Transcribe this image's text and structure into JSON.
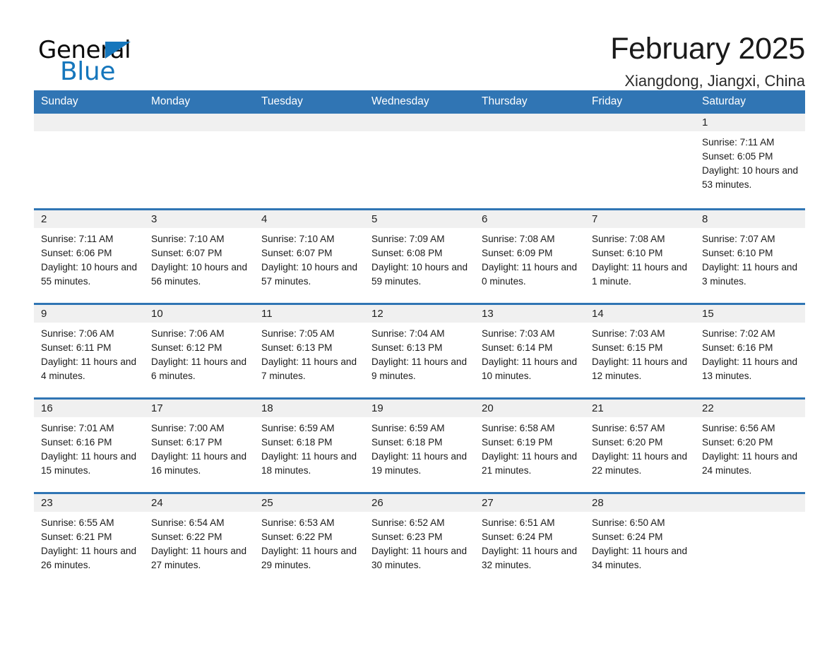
{
  "brand": {
    "name_part1": "General",
    "name_part2": "Blue",
    "accent_color": "#1576bc"
  },
  "header": {
    "title": "February 2025",
    "subtitle": "Xiangdong, Jiangxi, China"
  },
  "calendar": {
    "header_bg": "#3075b4",
    "daynum_bg": "#f0f0f0",
    "weekday_headers": [
      "Sunday",
      "Monday",
      "Tuesday",
      "Wednesday",
      "Thursday",
      "Friday",
      "Saturday"
    ],
    "weeks": [
      [
        {
          "day": "",
          "sunrise": "",
          "sunset": "",
          "daylight": ""
        },
        {
          "day": "",
          "sunrise": "",
          "sunset": "",
          "daylight": ""
        },
        {
          "day": "",
          "sunrise": "",
          "sunset": "",
          "daylight": ""
        },
        {
          "day": "",
          "sunrise": "",
          "sunset": "",
          "daylight": ""
        },
        {
          "day": "",
          "sunrise": "",
          "sunset": "",
          "daylight": ""
        },
        {
          "day": "",
          "sunrise": "",
          "sunset": "",
          "daylight": ""
        },
        {
          "day": "1",
          "sunrise": "Sunrise: 7:11 AM",
          "sunset": "Sunset: 6:05 PM",
          "daylight": "Daylight: 10 hours and 53 minutes."
        }
      ],
      [
        {
          "day": "2",
          "sunrise": "Sunrise: 7:11 AM",
          "sunset": "Sunset: 6:06 PM",
          "daylight": "Daylight: 10 hours and 55 minutes."
        },
        {
          "day": "3",
          "sunrise": "Sunrise: 7:10 AM",
          "sunset": "Sunset: 6:07 PM",
          "daylight": "Daylight: 10 hours and 56 minutes."
        },
        {
          "day": "4",
          "sunrise": "Sunrise: 7:10 AM",
          "sunset": "Sunset: 6:07 PM",
          "daylight": "Daylight: 10 hours and 57 minutes."
        },
        {
          "day": "5",
          "sunrise": "Sunrise: 7:09 AM",
          "sunset": "Sunset: 6:08 PM",
          "daylight": "Daylight: 10 hours and 59 minutes."
        },
        {
          "day": "6",
          "sunrise": "Sunrise: 7:08 AM",
          "sunset": "Sunset: 6:09 PM",
          "daylight": "Daylight: 11 hours and 0 minutes."
        },
        {
          "day": "7",
          "sunrise": "Sunrise: 7:08 AM",
          "sunset": "Sunset: 6:10 PM",
          "daylight": "Daylight: 11 hours and 1 minute."
        },
        {
          "day": "8",
          "sunrise": "Sunrise: 7:07 AM",
          "sunset": "Sunset: 6:10 PM",
          "daylight": "Daylight: 11 hours and 3 minutes."
        }
      ],
      [
        {
          "day": "9",
          "sunrise": "Sunrise: 7:06 AM",
          "sunset": "Sunset: 6:11 PM",
          "daylight": "Daylight: 11 hours and 4 minutes."
        },
        {
          "day": "10",
          "sunrise": "Sunrise: 7:06 AM",
          "sunset": "Sunset: 6:12 PM",
          "daylight": "Daylight: 11 hours and 6 minutes."
        },
        {
          "day": "11",
          "sunrise": "Sunrise: 7:05 AM",
          "sunset": "Sunset: 6:13 PM",
          "daylight": "Daylight: 11 hours and 7 minutes."
        },
        {
          "day": "12",
          "sunrise": "Sunrise: 7:04 AM",
          "sunset": "Sunset: 6:13 PM",
          "daylight": "Daylight: 11 hours and 9 minutes."
        },
        {
          "day": "13",
          "sunrise": "Sunrise: 7:03 AM",
          "sunset": "Sunset: 6:14 PM",
          "daylight": "Daylight: 11 hours and 10 minutes."
        },
        {
          "day": "14",
          "sunrise": "Sunrise: 7:03 AM",
          "sunset": "Sunset: 6:15 PM",
          "daylight": "Daylight: 11 hours and 12 minutes."
        },
        {
          "day": "15",
          "sunrise": "Sunrise: 7:02 AM",
          "sunset": "Sunset: 6:16 PM",
          "daylight": "Daylight: 11 hours and 13 minutes."
        }
      ],
      [
        {
          "day": "16",
          "sunrise": "Sunrise: 7:01 AM",
          "sunset": "Sunset: 6:16 PM",
          "daylight": "Daylight: 11 hours and 15 minutes."
        },
        {
          "day": "17",
          "sunrise": "Sunrise: 7:00 AM",
          "sunset": "Sunset: 6:17 PM",
          "daylight": "Daylight: 11 hours and 16 minutes."
        },
        {
          "day": "18",
          "sunrise": "Sunrise: 6:59 AM",
          "sunset": "Sunset: 6:18 PM",
          "daylight": "Daylight: 11 hours and 18 minutes."
        },
        {
          "day": "19",
          "sunrise": "Sunrise: 6:59 AM",
          "sunset": "Sunset: 6:18 PM",
          "daylight": "Daylight: 11 hours and 19 minutes."
        },
        {
          "day": "20",
          "sunrise": "Sunrise: 6:58 AM",
          "sunset": "Sunset: 6:19 PM",
          "daylight": "Daylight: 11 hours and 21 minutes."
        },
        {
          "day": "21",
          "sunrise": "Sunrise: 6:57 AM",
          "sunset": "Sunset: 6:20 PM",
          "daylight": "Daylight: 11 hours and 22 minutes."
        },
        {
          "day": "22",
          "sunrise": "Sunrise: 6:56 AM",
          "sunset": "Sunset: 6:20 PM",
          "daylight": "Daylight: 11 hours and 24 minutes."
        }
      ],
      [
        {
          "day": "23",
          "sunrise": "Sunrise: 6:55 AM",
          "sunset": "Sunset: 6:21 PM",
          "daylight": "Daylight: 11 hours and 26 minutes."
        },
        {
          "day": "24",
          "sunrise": "Sunrise: 6:54 AM",
          "sunset": "Sunset: 6:22 PM",
          "daylight": "Daylight: 11 hours and 27 minutes."
        },
        {
          "day": "25",
          "sunrise": "Sunrise: 6:53 AM",
          "sunset": "Sunset: 6:22 PM",
          "daylight": "Daylight: 11 hours and 29 minutes."
        },
        {
          "day": "26",
          "sunrise": "Sunrise: 6:52 AM",
          "sunset": "Sunset: 6:23 PM",
          "daylight": "Daylight: 11 hours and 30 minutes."
        },
        {
          "day": "27",
          "sunrise": "Sunrise: 6:51 AM",
          "sunset": "Sunset: 6:24 PM",
          "daylight": "Daylight: 11 hours and 32 minutes."
        },
        {
          "day": "28",
          "sunrise": "Sunrise: 6:50 AM",
          "sunset": "Sunset: 6:24 PM",
          "daylight": "Daylight: 11 hours and 34 minutes."
        },
        {
          "day": "",
          "sunrise": "",
          "sunset": "",
          "daylight": ""
        }
      ]
    ]
  }
}
